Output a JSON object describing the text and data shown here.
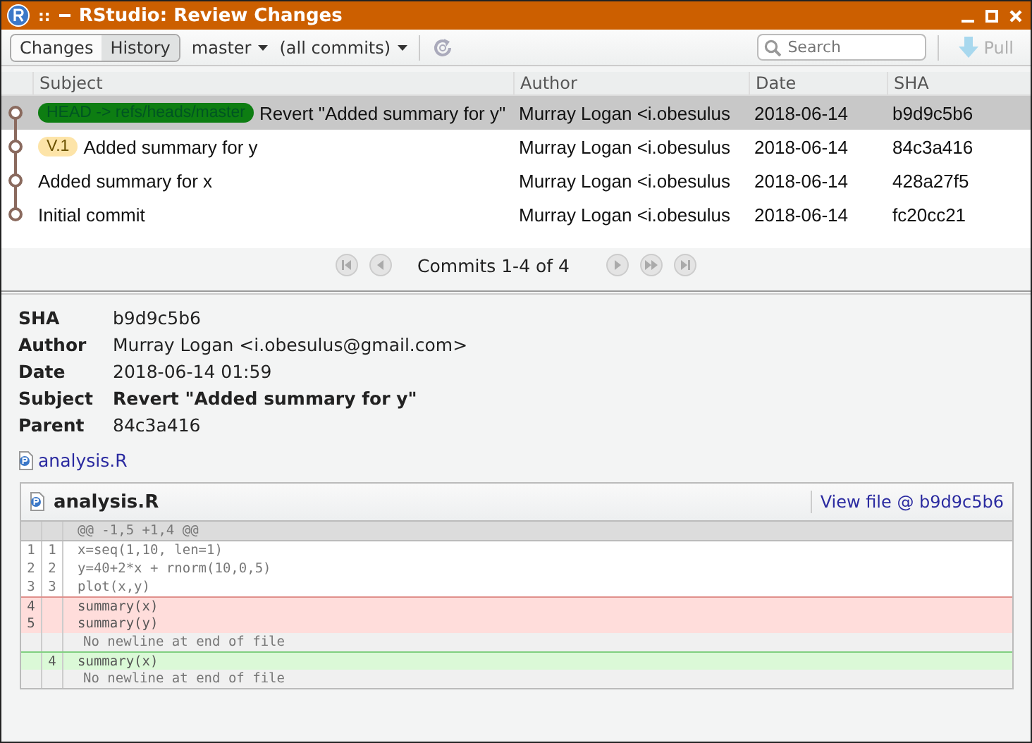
{
  "window": {
    "title": "RStudio: Review Changes",
    "menu_glyph": "::"
  },
  "toolbar": {
    "tabs": [
      {
        "label": "Changes",
        "selected": false
      },
      {
        "label": "History",
        "selected": true
      }
    ],
    "branch": "master",
    "filter": "(all commits)",
    "search": {
      "placeholder": "Search"
    },
    "pull": {
      "label": "Pull",
      "disabled": true
    }
  },
  "table": {
    "columns": [
      "Subject",
      "Author",
      "Date",
      "SHA"
    ],
    "rows": [
      {
        "selected": true,
        "refs": [
          {
            "kind": "branch",
            "label": "HEAD -> refs/heads/master"
          }
        ],
        "subject": "Revert \"Added summary for y\"",
        "author": "Murray Logan <i.obesulus",
        "date": "2018-06-14",
        "sha": "b9d9c5b6"
      },
      {
        "selected": false,
        "refs": [
          {
            "kind": "tag",
            "label": "V.1"
          }
        ],
        "subject": "Added summary for y",
        "author": "Murray Logan <i.obesulus",
        "date": "2018-06-14",
        "sha": "84c3a416"
      },
      {
        "selected": false,
        "subject": "Added summary for x",
        "author": "Murray Logan <i.obesulus",
        "date": "2018-06-14",
        "sha": "428a27f5"
      },
      {
        "selected": false,
        "subject": "Initial commit",
        "author": "Murray Logan <i.obesulus",
        "date": "2018-06-14",
        "sha": "fc20cc21"
      }
    ]
  },
  "pager": {
    "label": "Commits 1-4 of 4"
  },
  "details": [
    {
      "key": "SHA",
      "value": "b9d9c5b6",
      "bold": false
    },
    {
      "key": "Author",
      "value": "Murray Logan <i.obesulus@gmail.com>",
      "bold": false
    },
    {
      "key": "Date",
      "value": "2018-06-14 01:59",
      "bold": false
    },
    {
      "key": "Subject",
      "value": "Revert \"Added summary for y\"",
      "bold": true
    },
    {
      "key": "Parent",
      "value": "84c3a416",
      "bold": false
    }
  ],
  "files": [
    "analysis.R"
  ],
  "diff": {
    "file": "analysis.R",
    "view_link": "View file @ b9d9c5b6",
    "hunk": "@@ -1,5 +1,4 @@",
    "lines": [
      {
        "kind": "context",
        "old": "1",
        "new": "1",
        "text": "x=seq(1,10, len=1)"
      },
      {
        "kind": "context",
        "old": "2",
        "new": "2",
        "text": "y=40+2*x + rnorm(10,0,5)"
      },
      {
        "kind": "context",
        "old": "3",
        "new": "3",
        "text": "plot(x,y)"
      },
      {
        "kind": "deleted",
        "old": "4",
        "text": "summary(x)"
      },
      {
        "kind": "deleted",
        "old": "5",
        "text": "summary(y)"
      },
      {
        "kind": "note",
        "text": "No newline at end of file"
      },
      {
        "kind": "added",
        "new": "4",
        "text": "summary(x)"
      },
      {
        "kind": "note",
        "text": "No newline at end of file"
      }
    ]
  }
}
